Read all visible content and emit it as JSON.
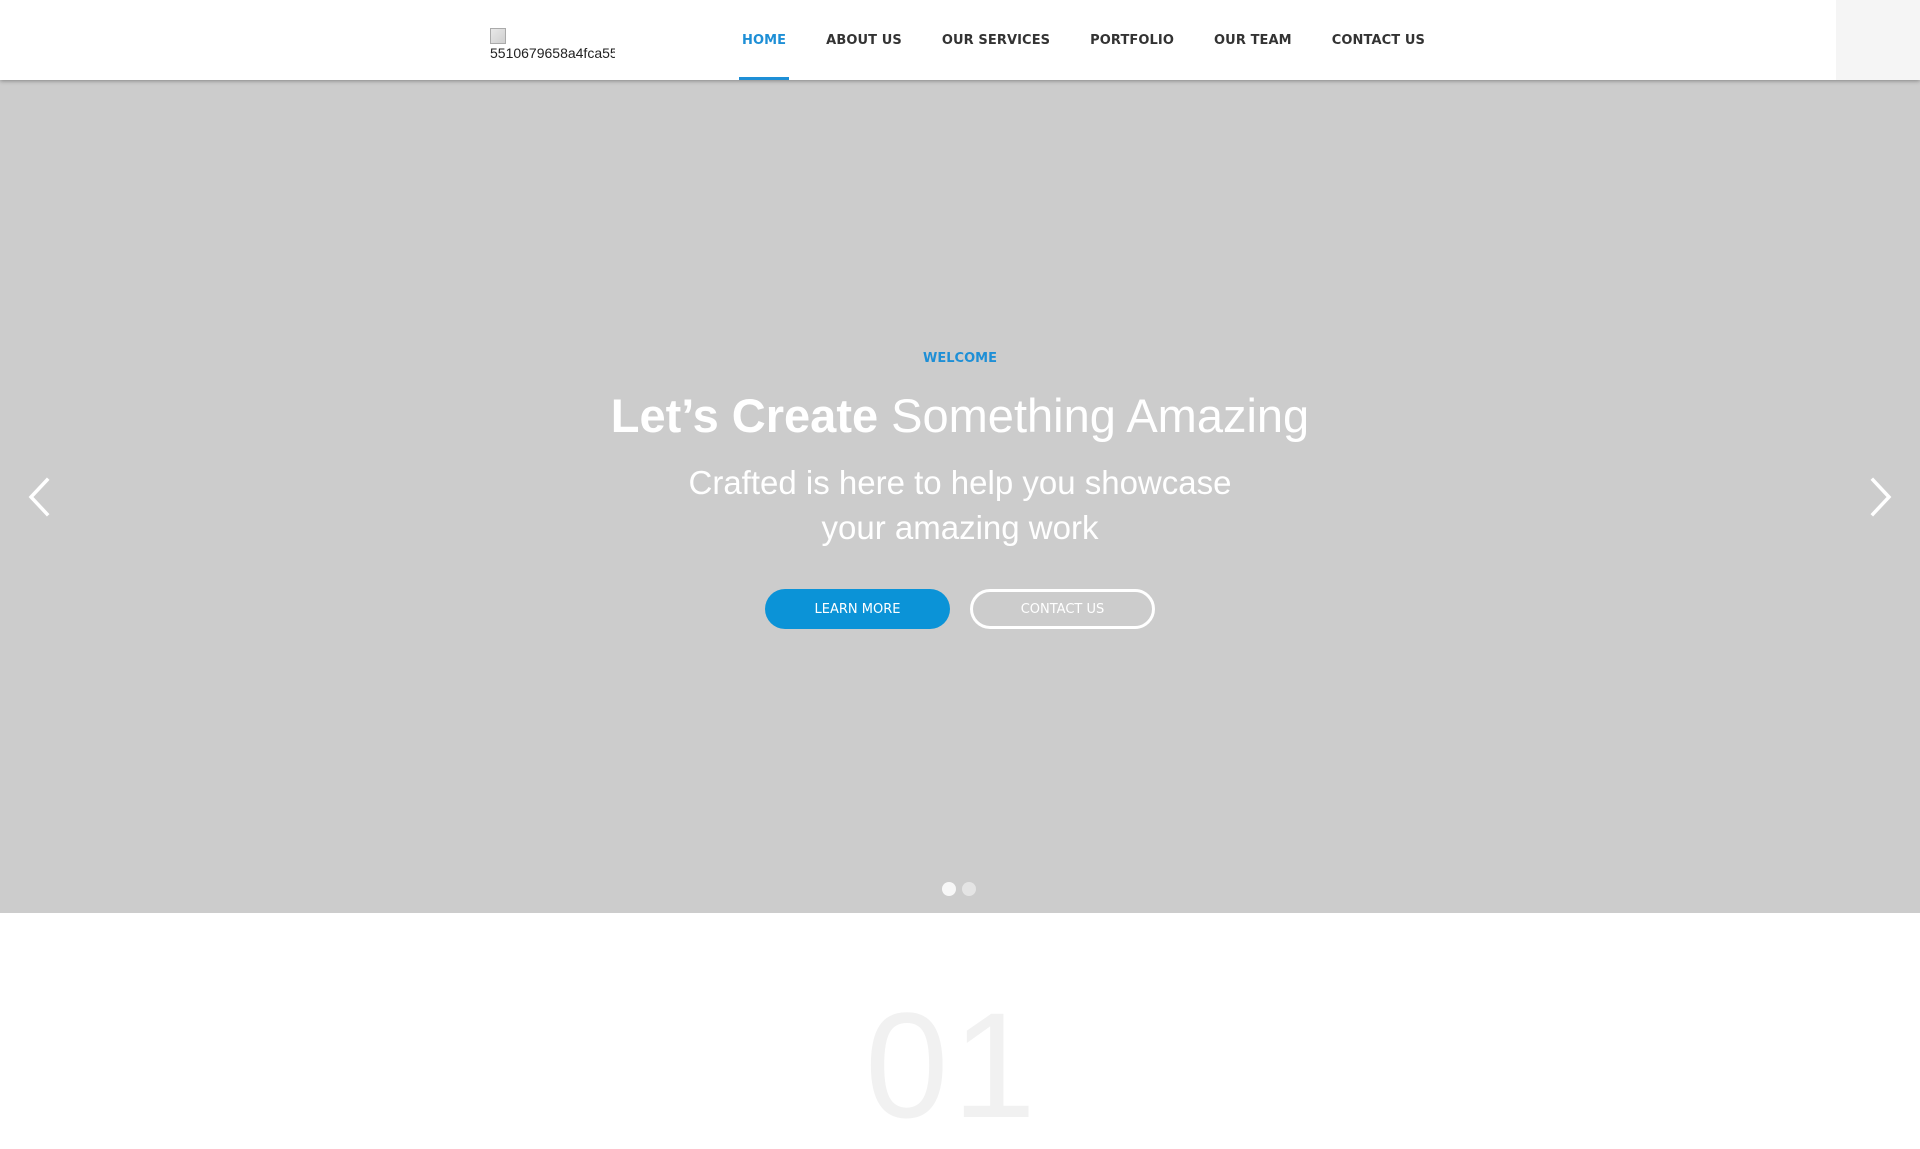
{
  "logo": {
    "alt_text": "5510679658a4fca55"
  },
  "nav": {
    "items": [
      {
        "label": "HOME",
        "active": true
      },
      {
        "label": "ABOUT US"
      },
      {
        "label": "OUR SERVICES"
      },
      {
        "label": "PORTFOLIO"
      },
      {
        "label": "OUR TEAM"
      },
      {
        "label": "CONTACT US"
      }
    ]
  },
  "hero": {
    "eyebrow": "WELCOME",
    "headline_strong": "Let’s Create",
    "headline_light": "Something Amazing",
    "subtext_line1": "Crafted is here to help you showcase",
    "subtext_line2": "your amazing work",
    "primary_button": "LEARN MORE",
    "secondary_button": "CONTACT US",
    "prev_icon": "chevron-left-icon",
    "next_icon": "chevron-right-icon",
    "slide_count": 2,
    "active_slide": 1
  },
  "section": {
    "number": "01"
  },
  "colors": {
    "accent": "#1e8fd6",
    "button": "#0b93d7",
    "hero_bg": "#cccccc"
  }
}
